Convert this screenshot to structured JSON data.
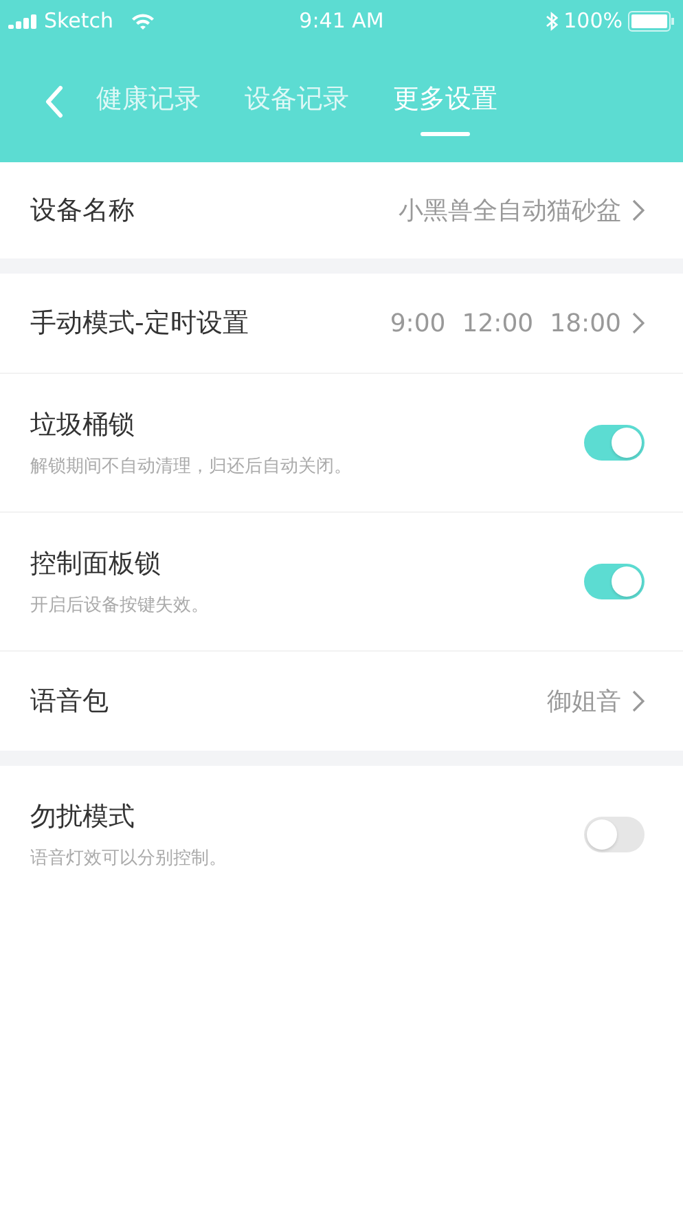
{
  "status_bar": {
    "carrier": "Sketch",
    "time": "9:41 AM",
    "battery": "100%"
  },
  "nav": {
    "tabs": [
      {
        "label": "健康记录",
        "selected": false
      },
      {
        "label": "设备记录",
        "selected": false
      },
      {
        "label": "更多设置",
        "selected": true
      }
    ]
  },
  "groups": [
    {
      "rows": [
        {
          "kind": "value",
          "title": "设备名称",
          "values": [
            "小黑兽全自动猫砂盆"
          ]
        }
      ]
    },
    {
      "rows": [
        {
          "kind": "value",
          "title": "手动模式-定时设置",
          "values": [
            "9:00",
            "12:00",
            "18:00"
          ]
        },
        {
          "kind": "toggle",
          "title": "垃圾桶锁",
          "subtitle": "解锁期间不自动清理，归还后自动关闭。",
          "on": true
        },
        {
          "kind": "toggle",
          "title": "控制面板锁",
          "subtitle": "开启后设备按键失效。",
          "on": true
        },
        {
          "kind": "value",
          "title": "语音包",
          "values": [
            "御姐音"
          ]
        }
      ]
    },
    {
      "rows": [
        {
          "kind": "toggle",
          "title": "勿扰模式",
          "subtitle": "语音灯效可以分别控制。",
          "on": false
        }
      ]
    }
  ]
}
